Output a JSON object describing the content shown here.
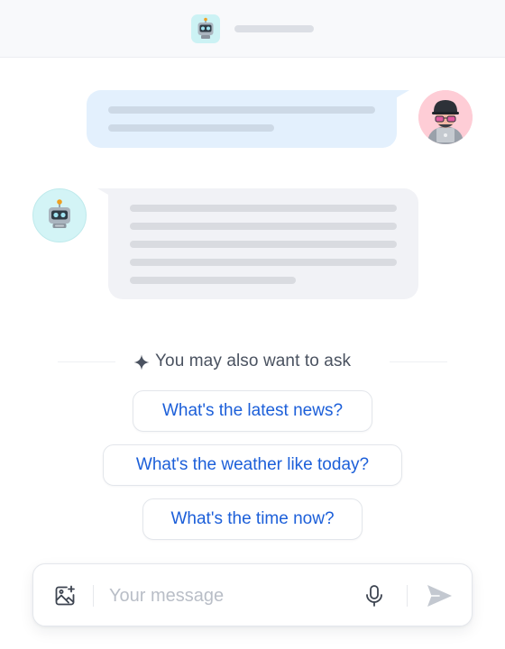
{
  "header": {
    "avatar_icon": "robot-icon"
  },
  "conversation": {
    "user_message": {
      "avatar_icon": "user-avatar-icon",
      "content": "placeholder-lines"
    },
    "bot_message": {
      "avatar_icon": "robot-icon",
      "content": "placeholder-lines"
    }
  },
  "suggestions": {
    "title": "You may also want to ask",
    "icon": "sparkle-icon",
    "items": [
      "What's the latest news?",
      "What's the weather like today?",
      "What's the time now?"
    ]
  },
  "composer": {
    "placeholder": "Your message",
    "value": "",
    "icons": [
      "image-add-icon",
      "microphone-icon",
      "send-icon"
    ]
  },
  "colors": {
    "accent": "#1c5fd9",
    "user_bubble": "#e3f0fd",
    "bot_bubble": "#f1f2f6",
    "bot_avatar_bg": "#d3f4f6",
    "user_avatar_bg": "#fecdd6"
  }
}
